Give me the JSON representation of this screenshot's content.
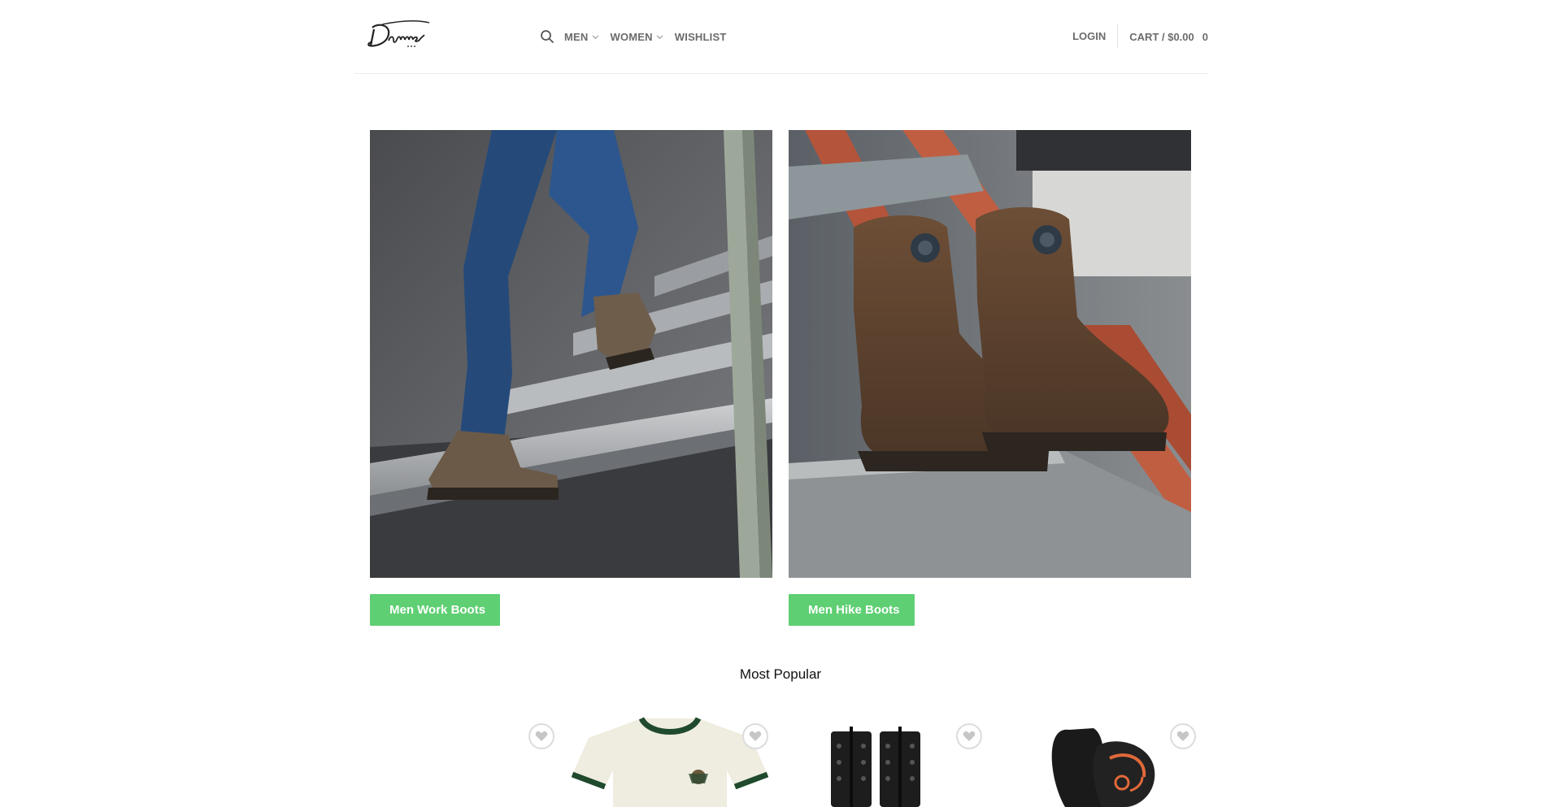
{
  "header": {
    "logo_alt": "Danner",
    "nav": [
      {
        "label": "MEN",
        "has_dropdown": true
      },
      {
        "label": "WOMEN",
        "has_dropdown": true
      },
      {
        "label": "WISHLIST",
        "has_dropdown": false
      }
    ],
    "login_label": "LOGIN",
    "cart_label": "CART / $0.00",
    "cart_count": "0"
  },
  "banners": [
    {
      "button_label": "Men Work Boots"
    },
    {
      "button_label": "Men Hike Boots"
    }
  ],
  "section_title": "Most Popular",
  "products": [
    {
      "image": "empty"
    },
    {
      "image": "ringer-tee"
    },
    {
      "image": "boot-laces"
    },
    {
      "image": "insole"
    }
  ],
  "colors": {
    "accent": "#5fcf73",
    "nav_text": "#6b6b6b",
    "border": "#ececec"
  },
  "icons": {
    "search": "search-icon",
    "chevron": "chevron-down-icon",
    "wishlist": "heart-icon"
  }
}
